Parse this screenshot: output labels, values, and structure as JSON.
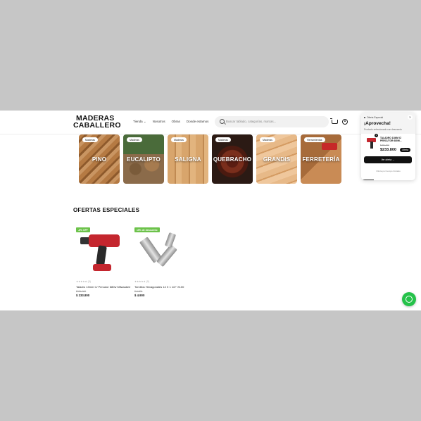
{
  "brand": {
    "line1": "MADERAS",
    "line2": "CABALLERO"
  },
  "nav": [
    "Tienda ⌄",
    "Nosotros",
    "Obras",
    "Donde estamos"
  ],
  "search": {
    "placeholder": "Buscar tablado, categorías, marcas..."
  },
  "categories": [
    {
      "badge": "Maderas",
      "name": "PINO"
    },
    {
      "badge": "Maderas",
      "name": "EUCALIPTO"
    },
    {
      "badge": "Maderas",
      "name": "SALIGNA"
    },
    {
      "badge": "Maderas",
      "name": "QUEBRACHO"
    },
    {
      "badge": "Maderas",
      "name": "GRANDIS"
    },
    {
      "badge": "Herramientas",
      "name": "FERRETERÍA"
    }
  ],
  "offers": {
    "title": "OFERTAS ESPECIALES",
    "products": [
      {
        "badge": "-8% OFF",
        "stars": "★★★★★ (0)",
        "name": "Taladro 13mm C/ Percutor 680w Milwaukee",
        "old_price": "$254.000",
        "price": "$ 233.800"
      },
      {
        "badge": "15% de descuento",
        "stars": "★★★★★ (0)",
        "name": "Tornillos Hexagonales 14 X 1 1/2\" X100",
        "old_price": "$ 5.800",
        "price": "$ 4.900"
      }
    ]
  },
  "popup": {
    "kicker": "Oferta Especial",
    "headline": "¡Aprovecha!",
    "subtitle": "Producto seleccionado con descuento",
    "count": "1",
    "product_name": "TALADRO 13MM C/ PERCUTOR 680W...",
    "old_price": "$254.000",
    "price": "$233.800",
    "tag": "Oferta",
    "cta": "Ver oferta  →",
    "footer": "Oferta por tiempo limitado",
    "close": "×"
  },
  "colors": {
    "accent_green": "#6cc24a",
    "whatsapp": "#25c24a",
    "dark": "#111111"
  }
}
